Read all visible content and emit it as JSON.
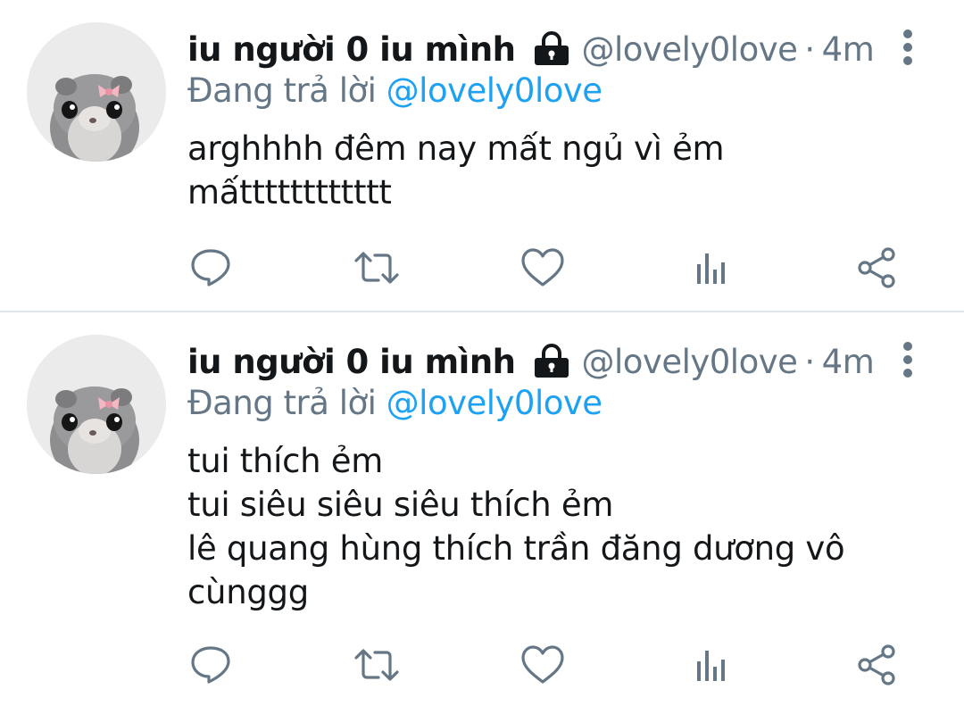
{
  "colors": {
    "text_primary": "#14171a",
    "text_secondary": "#657786",
    "mention": "#1da1f2",
    "divider": "#e1e8ed"
  },
  "tweets": [
    {
      "display_name": "iu người 0 iu mình",
      "handle": "@lovely0love",
      "separator": "·",
      "time": "4m",
      "reply_prefix": "Đang trả lời",
      "reply_mention": "@lovely0love",
      "text": "arghhhh đêm nay mất ngủ vì ẻm\nmấtttttttttttt",
      "avatar_icon": "hamster-with-bow-avatar",
      "protected_icon": "lock-icon",
      "menu_icon": "more-vertical-icon"
    },
    {
      "display_name": "iu người 0 iu mình",
      "handle": "@lovely0love",
      "separator": "·",
      "time": "4m",
      "reply_prefix": "Đang trả lời",
      "reply_mention": "@lovely0love",
      "text": "tui thích ẻm\ntui siêu siêu siêu thích ẻm\nlê quang hùng thích trần đăng dương vô\ncùnggg",
      "avatar_icon": "hamster-with-bow-avatar",
      "protected_icon": "lock-icon",
      "menu_icon": "more-vertical-icon"
    }
  ],
  "action_icons": [
    "reply-icon",
    "retweet-icon",
    "like-icon",
    "analytics-icon",
    "share-icon"
  ]
}
